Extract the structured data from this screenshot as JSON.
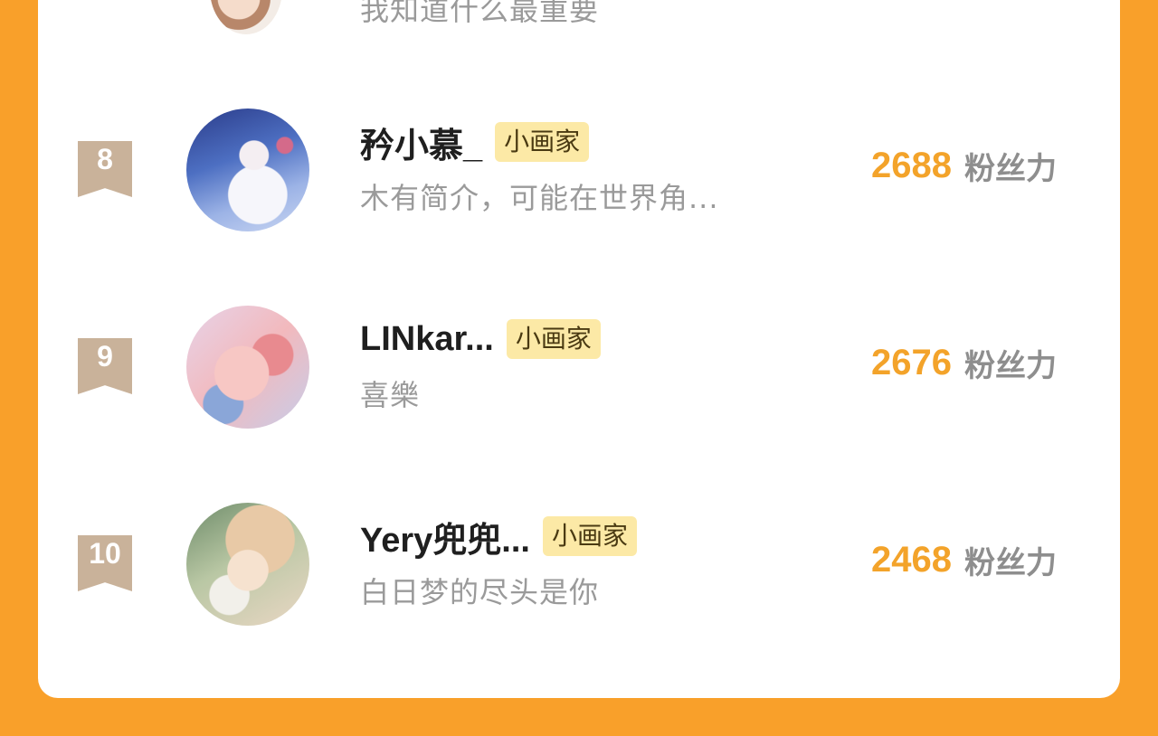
{
  "top_partial": {
    "description": "我知道什么最重要"
  },
  "ranking": [
    {
      "rank": "8",
      "name": "矜小慕_",
      "badge": "小画家",
      "description": "木有简介，可能在世界角...",
      "fans": "2688",
      "fans_label": "粉丝力"
    },
    {
      "rank": "9",
      "name": "LINkar...",
      "badge": "小画家",
      "description": "喜樂",
      "fans": "2676",
      "fans_label": "粉丝力"
    },
    {
      "rank": "10",
      "name": "Yery兜兜...",
      "badge": "小画家",
      "description": "白日梦的尽头是你",
      "fans": "2468",
      "fans_label": "粉丝力"
    }
  ],
  "colors": {
    "background": "#f9a02a",
    "card": "#ffffff",
    "fans_number": "#f3a32a",
    "badge_bg": "#fce9a6",
    "rank_flag": "#c9b29a"
  }
}
